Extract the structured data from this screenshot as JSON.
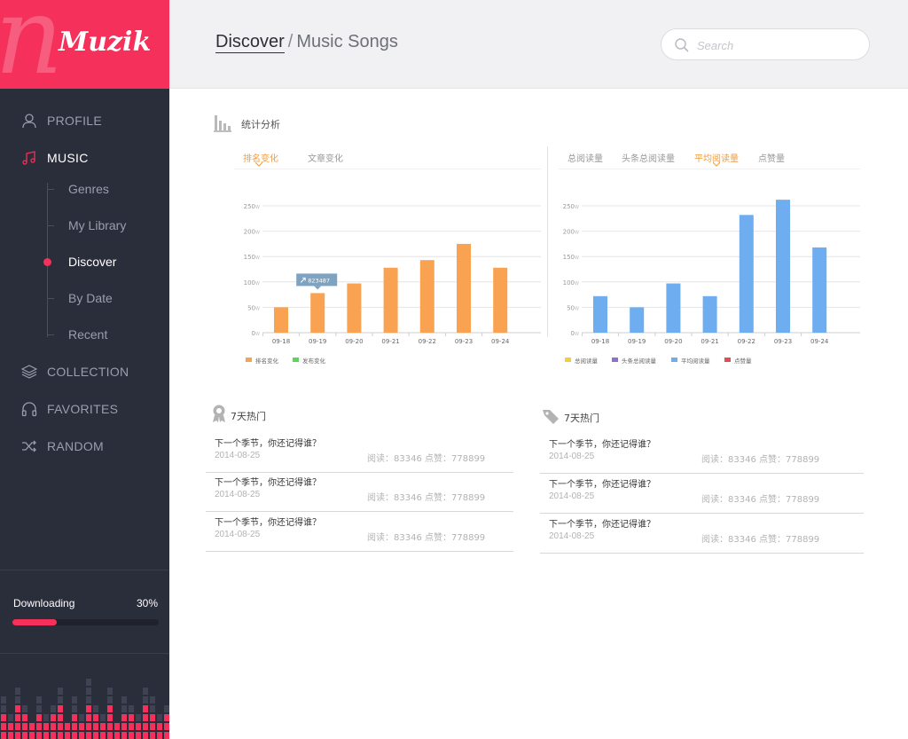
{
  "brand": {
    "letter": "n",
    "name": "Muzik",
    "color": "#f5305a"
  },
  "nav": {
    "profile": "PROFILE",
    "music": "MUSIC",
    "music_sub": [
      "Genres",
      "My Library",
      "Discover",
      "By Date",
      "Recent"
    ],
    "active_sub": "Discover",
    "collection": "COLLECTION",
    "favorites": "FAVORITES",
    "random": "RANDOM"
  },
  "download": {
    "label": "Downloading",
    "percent_text": "30%",
    "progress": 0.3
  },
  "header": {
    "breadcrumb_current": "Discover",
    "breadcrumb_sep": "/",
    "breadcrumb_page": "Music Songs"
  },
  "search": {
    "placeholder": "Search",
    "value": ""
  },
  "stats": {
    "title": "统计分析",
    "left_tabs": [
      "排名变化",
      "文章变化"
    ],
    "left_active": 0,
    "right_tabs": [
      "总阅读量",
      "头条总阅读量",
      "平均阅读量",
      "点赞量"
    ],
    "right_active": 2
  },
  "chart_data": [
    {
      "type": "bar",
      "categories": [
        "09-18",
        "09-19",
        "09-20",
        "09-21",
        "09-22",
        "09-23",
        "09-24"
      ],
      "series": [
        {
          "name": "排名变化",
          "values": [
            50,
            78,
            97,
            128,
            143,
            175,
            128
          ],
          "color": "#f9a252"
        }
      ],
      "legend": [
        {
          "name": "排名变化",
          "color": "#f9a252"
        },
        {
          "name": "发布变化",
          "color": "#5ed35e"
        }
      ],
      "yticks": [
        "0",
        "50",
        "100",
        "150",
        "200",
        "250"
      ],
      "yunit": "W",
      "ylim": [
        0,
        250
      ],
      "tooltip": "823487",
      "tooltip_category": "09-19",
      "grid": true,
      "legend_position": "bottom-left"
    },
    {
      "type": "bar",
      "categories": [
        "09-18",
        "09-19",
        "09-20",
        "09-21",
        "09-22",
        "09-23",
        "09-24"
      ],
      "series": [
        {
          "name": "平均阅读量",
          "values": [
            72,
            50,
            97,
            72,
            232,
            262,
            168
          ],
          "color": "#6eaef0"
        }
      ],
      "legend": [
        {
          "name": "总阅读量",
          "color": "#f5cf3a"
        },
        {
          "name": "头条总阅读量",
          "color": "#8e72c7"
        },
        {
          "name": "平均阅读量",
          "color": "#6eaef0"
        },
        {
          "name": "点赞量",
          "color": "#e24d4d"
        }
      ],
      "yticks": [
        "0",
        "50",
        "100",
        "150",
        "200",
        "250"
      ],
      "yunit": "W",
      "ylim": [
        0,
        250
      ],
      "grid": true,
      "legend_position": "bottom-left"
    }
  ],
  "hot_left": {
    "title": "7天热门",
    "items": [
      {
        "title": "下一个季节，你还记得谁？",
        "date": "2014-08-25",
        "meta": "阅读：83346 点赞：778899"
      },
      {
        "title": "下一个季节，你还记得谁？",
        "date": "2014-08-25",
        "meta": "阅读：83346 点赞：778899"
      },
      {
        "title": "下一个季节，你还记得谁？",
        "date": "2014-08-25",
        "meta": "阅读：83346 点赞：778899"
      }
    ]
  },
  "hot_right": {
    "title": "7天热门",
    "items": [
      {
        "title": "下一个季节，你还记得谁？",
        "date": "2014-08-25",
        "meta": "阅读：83346 点赞：778899"
      },
      {
        "title": "下一个季节，你还记得谁？",
        "date": "2014-08-25",
        "meta": "阅读：83346 点赞：778899"
      },
      {
        "title": "下一个季节，你还记得谁？",
        "date": "2014-08-25",
        "meta": "阅读：83346 点赞：778899"
      }
    ]
  }
}
